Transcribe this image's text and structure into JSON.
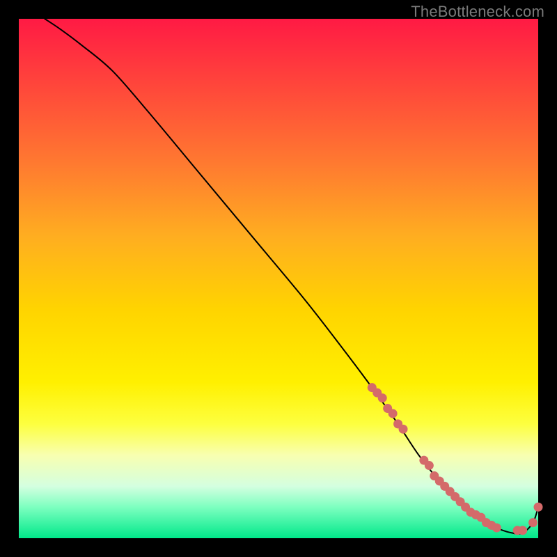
{
  "watermark": "TheBottleneck.com",
  "colors": {
    "dot": "#d46a6a",
    "line": "#000000",
    "frame": "#000000"
  },
  "chart_data": {
    "type": "line",
    "title": "",
    "xlabel": "",
    "ylabel": "",
    "xlim": [
      0,
      100
    ],
    "ylim": [
      0,
      100
    ],
    "grid": false,
    "series": [
      {
        "name": "bottleneck-curve",
        "x": [
          5,
          8,
          12,
          18,
          25,
          35,
          45,
          55,
          62,
          68,
          73,
          77,
          81,
          85,
          89,
          92,
          95,
          97,
          99,
          100
        ],
        "y": [
          100,
          98,
          95,
          90,
          82,
          70,
          58,
          46,
          37,
          29,
          22,
          16,
          11,
          7,
          4,
          2,
          1,
          1,
          3,
          6
        ]
      }
    ],
    "highlight_points": {
      "name": "dots",
      "x": [
        68,
        69,
        70,
        71,
        72,
        73,
        74,
        78,
        79,
        80,
        81,
        82,
        83,
        84,
        85,
        86,
        87,
        88,
        89,
        90,
        91,
        92,
        96,
        97,
        99,
        100
      ],
      "y": [
        29,
        28,
        27,
        25,
        24,
        22,
        21,
        15,
        14,
        12,
        11,
        10,
        9,
        8,
        7,
        6,
        5,
        4.5,
        4,
        3,
        2.5,
        2,
        1.5,
        1.5,
        3,
        6
      ]
    }
  }
}
